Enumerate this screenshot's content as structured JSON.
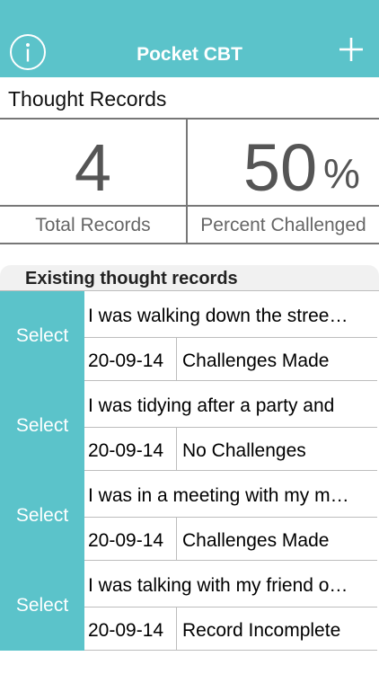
{
  "app": {
    "title": "Pocket CBT",
    "info_icon": "info-icon",
    "add_icon": "plus-icon",
    "accent_color": "#5bc3ca"
  },
  "section_title": "Thought Records",
  "stats": {
    "total_records": {
      "value": "4",
      "label": "Total Records"
    },
    "percent_challenged": {
      "value": "50",
      "unit": "%",
      "label": "Percent Challenged"
    }
  },
  "list": {
    "header": "Existing thought records",
    "select_label": "Select",
    "records": [
      {
        "description": "I was walking down the stree…",
        "date": "20-09-14",
        "status": "Challenges Made"
      },
      {
        "description": "I was tidying after a party and",
        "date": "20-09-14",
        "status": "No Challenges"
      },
      {
        "description": "I was in a meeting with my m…",
        "date": "20-09-14",
        "status": "Challenges Made"
      },
      {
        "description": "I was talking with my friend o…",
        "date": "20-09-14",
        "status": "Record Incomplete"
      }
    ]
  }
}
